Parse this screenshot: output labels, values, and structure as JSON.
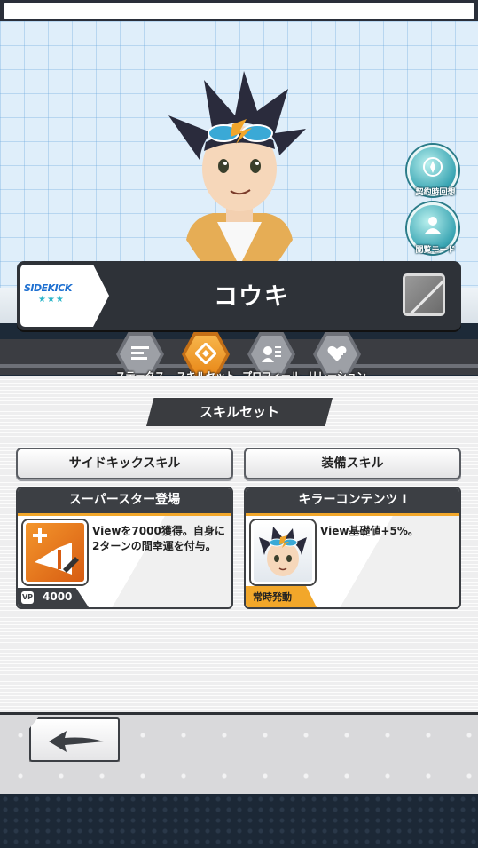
{
  "character": {
    "name": "コウキ",
    "rank_label": "SIDEKICK",
    "stars": "★★★"
  },
  "side_buttons": {
    "contract_recall": "契約時回想",
    "view_mode": "閲覧モード"
  },
  "tabs": [
    {
      "label": "ステータス",
      "icon": "status-icon",
      "active": false
    },
    {
      "label": "スキルセット",
      "icon": "skillset-icon",
      "active": true
    },
    {
      "label": "プロフィール",
      "icon": "profile-icon",
      "active": false
    },
    {
      "label": "リレーション",
      "icon": "relation-icon",
      "active": false
    }
  ],
  "section_title": "スキルセット",
  "categories": {
    "sidekick_skill": "サイドキックスキル",
    "equipped_skill": "装備スキル"
  },
  "sidekick_card": {
    "title": "スーパースター登場",
    "description": "Viewを7000獲得。自身に2ターンの間幸運を付与。",
    "cost_label": "VP",
    "cost_value": "4000",
    "icon": "megaphone-icon"
  },
  "equip_card": {
    "title": "キラーコンテンツ I",
    "description": "View基礎値+5%。",
    "tag": "常時発動",
    "icon": "character-face-icon"
  },
  "colors": {
    "accent_orange": "#f2a72a",
    "dark_panel": "#3c3f44",
    "sky_blue": "#dfeefa"
  }
}
